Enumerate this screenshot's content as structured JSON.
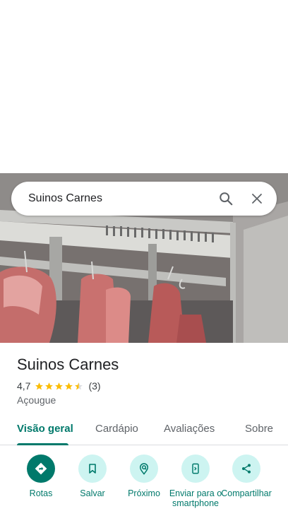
{
  "search": {
    "query": "Suinos Carnes"
  },
  "place": {
    "name": "Suinos Carnes",
    "rating": "4,7",
    "stars": 4.5,
    "review_count": "(3)",
    "category": "Açougue"
  },
  "tabs": [
    {
      "label": "Visão geral"
    },
    {
      "label": "Cardápio"
    },
    {
      "label": "Avaliações"
    },
    {
      "label": "Sobre"
    }
  ],
  "actions": [
    {
      "label": "Rotas",
      "icon": "directions-icon"
    },
    {
      "label": "Salvar",
      "icon": "bookmark-icon"
    },
    {
      "label": "Próximo",
      "icon": "nearby-icon"
    },
    {
      "label": "Enviar para o smartphone",
      "icon": "send-to-phone-icon"
    },
    {
      "label": "Compartilhar",
      "icon": "share-icon"
    }
  ],
  "colors": {
    "accent": "#00796b",
    "action_bg": "#cdf4f1",
    "star": "#fbbc04"
  }
}
